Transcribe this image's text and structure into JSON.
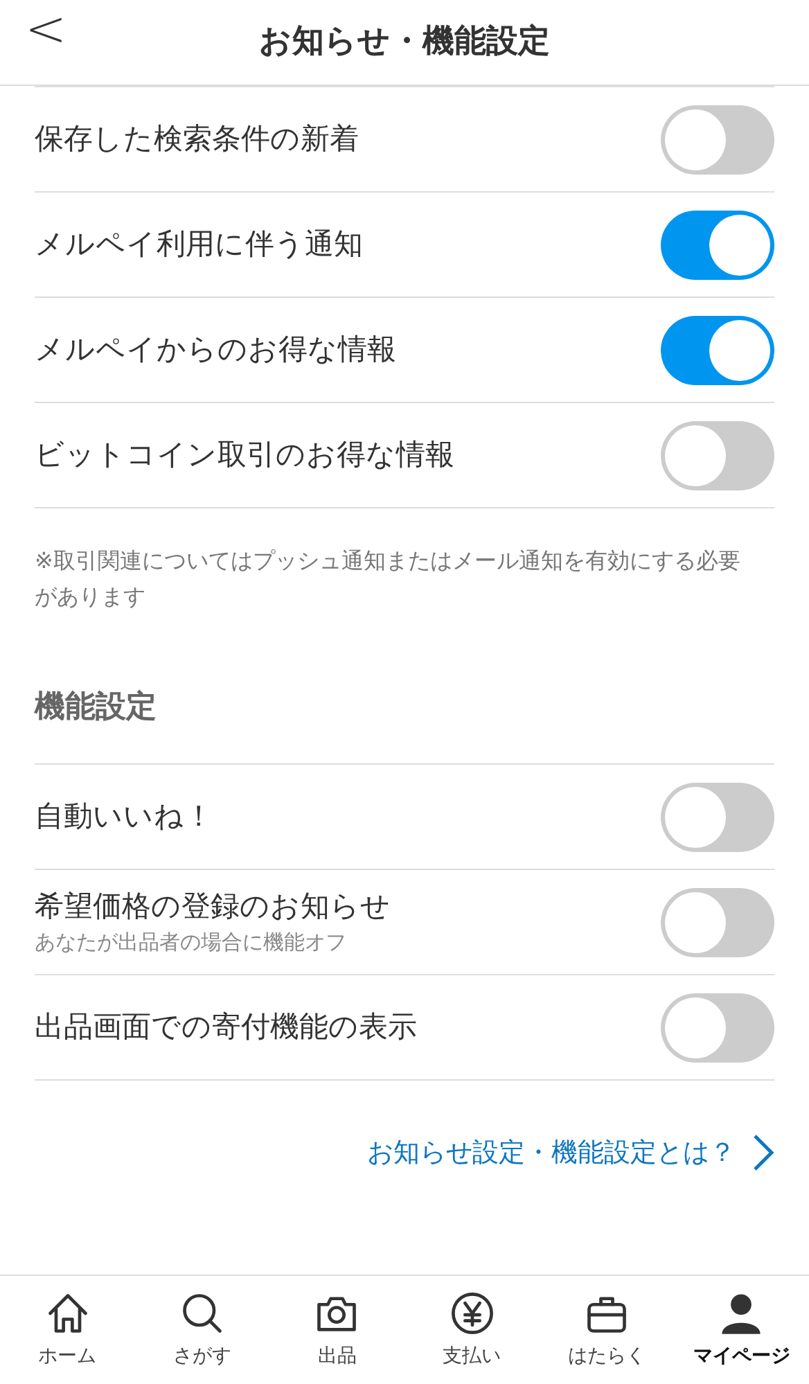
{
  "header": {
    "back": "<",
    "title": "お知らせ・機能設定"
  },
  "notification_settings": [
    {
      "label": "保存した検索条件の新着",
      "on": false
    },
    {
      "label": "メルペイ利用に伴う通知",
      "on": true
    },
    {
      "label": "メルペイからのお得な情報",
      "on": true
    },
    {
      "label": "ビットコイン取引のお得な情報",
      "on": false
    }
  ],
  "note": "※取引関連についてはプッシュ通知またはメール通知を有効にする必要があります",
  "feature_section": {
    "title": "機能設定",
    "items": [
      {
        "label": "自動いいね！",
        "on": false
      },
      {
        "label": "希望価格の登録のお知らせ",
        "sublabel": "あなたが出品者の場合に機能オフ",
        "on": false
      },
      {
        "label": "出品画面での寄付機能の表示",
        "on": false
      }
    ]
  },
  "help_link": "お知らせ設定・機能設定とは？",
  "tab_bar": [
    {
      "label": "ホーム",
      "selected": false
    },
    {
      "label": "さがす",
      "selected": false
    },
    {
      "label": "出品",
      "selected": false
    },
    {
      "label": "支払い",
      "selected": false
    },
    {
      "label": "はたらく",
      "selected": false
    },
    {
      "label": "マイページ",
      "selected": true
    }
  ]
}
